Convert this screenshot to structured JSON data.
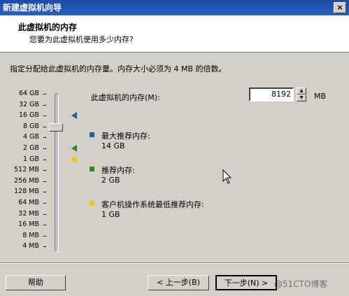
{
  "window": {
    "title": "新建虚拟机向导",
    "close_label": "×"
  },
  "header": {
    "title": "此虚拟机的内存",
    "subtitle": "您要为此虚拟机使用多少内存?"
  },
  "instruction": "指定分配给此虚拟机的内存量。内存大小必须为 4 MB 的倍数。",
  "memory": {
    "label": "此虚拟机的内存(M):",
    "value": "8192",
    "unit": "MB"
  },
  "chart_data": {
    "type": "slider",
    "ticks": [
      "64 GB",
      "32 GB",
      "16 GB",
      "8 GB",
      "4 GB",
      "2 GB",
      "1 GB",
      "512 MB",
      "256 MB",
      "128 MB",
      "64 MB",
      "32 MB",
      "16 MB",
      "8 MB",
      "4 MB"
    ],
    "selected_tick": "8 GB",
    "markers": [
      {
        "tick": "16 GB",
        "color": "#1f5fa8",
        "shape": "triangle"
      },
      {
        "tick": "2 GB",
        "color": "#2a8a2a",
        "shape": "triangle"
      },
      {
        "tick": "1 GB",
        "color": "#f0c419",
        "shape": "square"
      }
    ]
  },
  "legend": [
    {
      "title": "最大推荐内存:",
      "value": "14 GB",
      "color": "#1f5fa8"
    },
    {
      "title": "推荐内存:",
      "value": "2 GB",
      "color": "#2a8a2a"
    },
    {
      "title": "客户机操作系统最低推荐内存:",
      "value": "1 GB",
      "color": "#f0c419"
    }
  ],
  "buttons": {
    "help": "帮助",
    "back": "< 上一步(B)",
    "next": "下一步(N) >"
  },
  "watermark": "@51CTO博客"
}
